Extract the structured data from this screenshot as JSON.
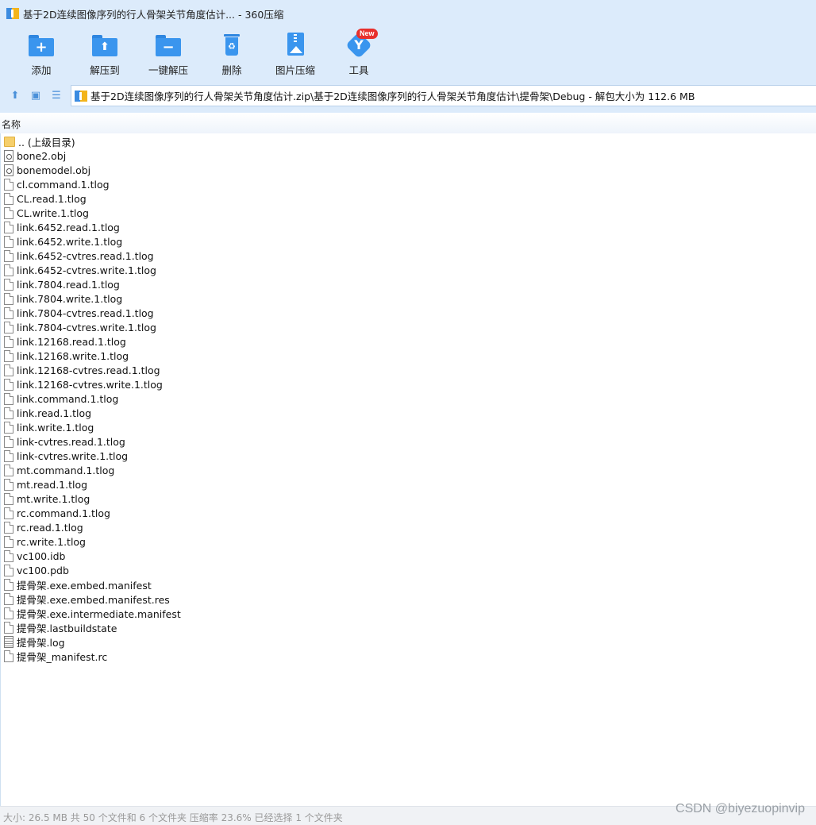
{
  "window": {
    "title": "基于2D连续图像序列的行人骨架关节角度估计... - 360压缩",
    "app_icon": "360-zip-app-icon"
  },
  "toolbar": {
    "buttons": [
      {
        "label": "添加",
        "icon": "add-icon"
      },
      {
        "label": "解压到",
        "icon": "extract-to-icon"
      },
      {
        "label": "一键解压",
        "icon": "one-click-extract-icon"
      },
      {
        "label": "删除",
        "icon": "delete-icon"
      },
      {
        "label": "图片压缩",
        "icon": "image-compress-icon"
      },
      {
        "label": "工具",
        "icon": "tools-icon",
        "badge": "New"
      }
    ]
  },
  "address_bar": {
    "path": "基于2D连续图像序列的行人骨架关节角度估计.zip\\基于2D连续图像序列的行人骨架关节角度估计\\提骨架\\Debug - 解包大小为 112.6 MB"
  },
  "file_list": {
    "column_header": "名称",
    "items": [
      {
        "name": ".. (上级目录)",
        "icon": "folder-icon"
      },
      {
        "name": "bone2.obj",
        "icon": "obj-file-icon"
      },
      {
        "name": "bonemodel.obj",
        "icon": "obj-file-icon"
      },
      {
        "name": "cl.command.1.tlog",
        "icon": "file-icon"
      },
      {
        "name": "CL.read.1.tlog",
        "icon": "file-icon"
      },
      {
        "name": "CL.write.1.tlog",
        "icon": "file-icon"
      },
      {
        "name": "link.6452.read.1.tlog",
        "icon": "file-icon"
      },
      {
        "name": "link.6452.write.1.tlog",
        "icon": "file-icon"
      },
      {
        "name": "link.6452-cvtres.read.1.tlog",
        "icon": "file-icon"
      },
      {
        "name": "link.6452-cvtres.write.1.tlog",
        "icon": "file-icon"
      },
      {
        "name": "link.7804.read.1.tlog",
        "icon": "file-icon"
      },
      {
        "name": "link.7804.write.1.tlog",
        "icon": "file-icon"
      },
      {
        "name": "link.7804-cvtres.read.1.tlog",
        "icon": "file-icon"
      },
      {
        "name": "link.7804-cvtres.write.1.tlog",
        "icon": "file-icon"
      },
      {
        "name": "link.12168.read.1.tlog",
        "icon": "file-icon"
      },
      {
        "name": "link.12168.write.1.tlog",
        "icon": "file-icon"
      },
      {
        "name": "link.12168-cvtres.read.1.tlog",
        "icon": "file-icon"
      },
      {
        "name": "link.12168-cvtres.write.1.tlog",
        "icon": "file-icon"
      },
      {
        "name": "link.command.1.tlog",
        "icon": "file-icon"
      },
      {
        "name": "link.read.1.tlog",
        "icon": "file-icon"
      },
      {
        "name": "link.write.1.tlog",
        "icon": "file-icon"
      },
      {
        "name": "link-cvtres.read.1.tlog",
        "icon": "file-icon"
      },
      {
        "name": "link-cvtres.write.1.tlog",
        "icon": "file-icon"
      },
      {
        "name": "mt.command.1.tlog",
        "icon": "file-icon"
      },
      {
        "name": "mt.read.1.tlog",
        "icon": "file-icon"
      },
      {
        "name": "mt.write.1.tlog",
        "icon": "file-icon"
      },
      {
        "name": "rc.command.1.tlog",
        "icon": "file-icon"
      },
      {
        "name": "rc.read.1.tlog",
        "icon": "file-icon"
      },
      {
        "name": "rc.write.1.tlog",
        "icon": "file-icon"
      },
      {
        "name": "vc100.idb",
        "icon": "file-icon"
      },
      {
        "name": "vc100.pdb",
        "icon": "file-icon"
      },
      {
        "name": "提骨架.exe.embed.manifest",
        "icon": "file-icon"
      },
      {
        "name": "提骨架.exe.embed.manifest.res",
        "icon": "file-icon"
      },
      {
        "name": "提骨架.exe.intermediate.manifest",
        "icon": "file-icon"
      },
      {
        "name": "提骨架.lastbuildstate",
        "icon": "file-icon"
      },
      {
        "name": "提骨架.log",
        "icon": "log-file-icon"
      },
      {
        "name": "提骨架_manifest.rc",
        "icon": "file-icon"
      }
    ]
  },
  "status_bar": {
    "text": "大小: 26.5 MB 共 50 个文件和 6 个文件夹 压缩率 23.6% 已经选择 1 个文件夹"
  },
  "watermark": "CSDN @biyezuopinvip",
  "colors": {
    "chrome_background": "#dcebfb",
    "icon_blue": "#3a95ee",
    "badge_red": "#e8302c",
    "folder_yellow": "#f6cf6b"
  }
}
